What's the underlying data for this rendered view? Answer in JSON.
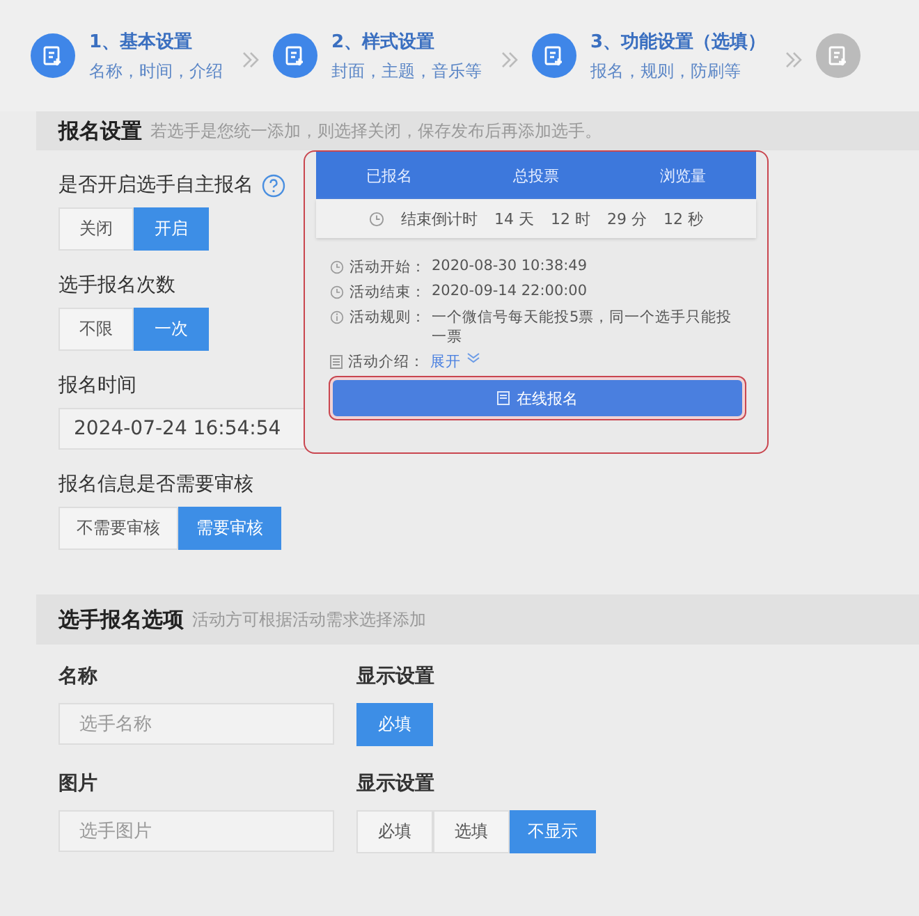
{
  "steps": [
    {
      "title": "1、基本设置",
      "subtitle": "名称，时间，介绍",
      "active": true
    },
    {
      "title": "2、样式设置",
      "subtitle": "封面，主题，音乐等",
      "active": true
    },
    {
      "title": "3、功能设置（选填）",
      "subtitle": "报名，规则，防刷等",
      "active": true
    },
    {
      "active": false
    }
  ],
  "signup": {
    "title": "报名设置",
    "hint": "若选手是您统一添加，则选择关闭，保存发布后再添加选手。",
    "fields": [
      {
        "kind": "toggle",
        "label": "是否开启选手自主报名",
        "help": true,
        "options": [
          {
            "label": "关闭",
            "selected": false
          },
          {
            "label": "开启",
            "selected": true
          }
        ]
      },
      {
        "kind": "toggle",
        "label": "选手报名次数",
        "help": false,
        "options": [
          {
            "label": "不限",
            "selected": false
          },
          {
            "label": "一次",
            "selected": true
          }
        ]
      },
      {
        "kind": "date",
        "label": "报名时间",
        "value": "2024-07-24 16:54:54"
      },
      {
        "kind": "toggle",
        "label": "报名信息是否需要审核",
        "help": false,
        "options": [
          {
            "label": "不需要审核",
            "selected": false
          },
          {
            "label": "需要审核",
            "selected": true
          }
        ]
      }
    ]
  },
  "preview": {
    "stats": [
      "已报名",
      "总投票",
      "浏览量"
    ],
    "countdown": {
      "label": "结束倒计时",
      "parts": [
        "14 天",
        "12 时",
        "29 分",
        "12 秒"
      ]
    },
    "info": [
      {
        "kind": "clock",
        "label": "活动开始：",
        "value": "2020-08-30   10:38:49"
      },
      {
        "kind": "clock",
        "label": "活动结束：",
        "value": "2020-09-14   22:00:00"
      },
      {
        "kind": "info",
        "label": "活动规则：",
        "value": "一个微信号每天能投5票，同一个选手只能投一票"
      },
      {
        "kind": "doc",
        "label": "活动介绍：",
        "link": "展开"
      }
    ],
    "button": "在线报名"
  },
  "options": {
    "title": "选手报名选项",
    "hint": "活动方可根据活动需求选择添加",
    "rows": [
      {
        "label": "名称",
        "placeholder": "选手名称",
        "display_label": "显示设置",
        "choices": [
          {
            "label": "必填",
            "selected": true
          }
        ]
      },
      {
        "label": "图片",
        "placeholder": "选手图片",
        "display_label": "显示设置",
        "choices": [
          {
            "label": "必填",
            "selected": false
          },
          {
            "label": "选填",
            "selected": false
          },
          {
            "label": "不显示",
            "selected": true
          }
        ]
      }
    ]
  }
}
